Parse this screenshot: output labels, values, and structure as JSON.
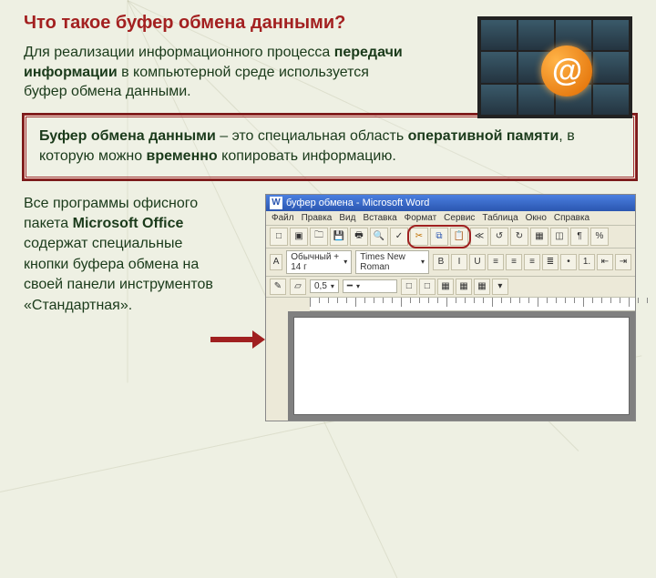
{
  "title": "Что такое буфер обмена данными?",
  "para1": {
    "pre": "Для реализации информационного процесса ",
    "b1": "передачи информации",
    "post": " в компьютерной среде используется буфер обмена данными."
  },
  "definition": {
    "b1": "Буфер обмена данными",
    "mid1": " – это специальная область ",
    "b2": "оперативной памяти",
    "mid2": ", в которую можно ",
    "b3": "временно",
    "post": " копировать информацию."
  },
  "para3": {
    "pre": "Все программы офисного пакета ",
    "b1": "Microsoft Office",
    "post": " содержат специальные кнопки буфера обмена на своей панели инструментов «Стандартная»."
  },
  "decor": {
    "at": "@"
  },
  "word": {
    "titlebar_icon": "W",
    "titlebar_text": "буфер обмена - Microsoft Word",
    "menu": [
      "Файл",
      "Правка",
      "Вид",
      "Вставка",
      "Формат",
      "Сервис",
      "Таблица",
      "Окно",
      "Справка"
    ],
    "toolbar1_icons": [
      "□",
      "▣",
      "🗀",
      "💾",
      "🖶",
      "🔍",
      "✓",
      "✂",
      "⧉",
      "📋",
      "≪",
      "↺",
      "↻",
      "▦",
      "◫",
      "¶",
      "%"
    ],
    "highlight_index_start": 7,
    "highlight_index_end": 9,
    "style_name": "Обычный + 14 г",
    "font_name": "Times New Roman",
    "fmt_icons": [
      "B",
      "I",
      "U",
      "≡",
      "≡",
      "≡",
      "≣",
      "•",
      "1.",
      "⇤",
      "⇥"
    ],
    "fmtbar3": {
      "size": "0,5",
      "unit": "▾",
      "extras": [
        "□",
        "□",
        "▦",
        "▦",
        "▦",
        "▾"
      ]
    }
  }
}
